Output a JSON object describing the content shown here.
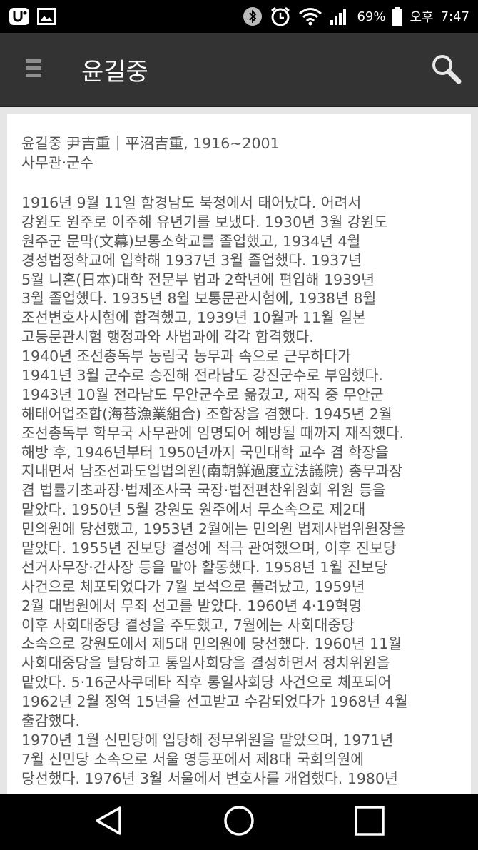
{
  "status_bar": {
    "battery_percent": "69%",
    "ampm": "오후",
    "time": "7:47"
  },
  "app_bar": {
    "title": "윤길중"
  },
  "entry": {
    "header": [
      "윤길중 尹吉重｜平沼吉重, 1916~2001",
      "사무관·군수"
    ],
    "body_lines": [
      "1916년 9월 11일 함경남도 북청에서 태어났다. 어려서",
      "강원도 원주로 이주해 유년기를 보냈다. 1930년 3월 강원도",
      "원주군 문막(文幕)보통소학교를 졸업했고, 1934년 4월",
      "경성법정학교에 입학해 1937년 3월 졸업했다. 1937년",
      "5월 니혼(日本)대학 전문부 법과 2학년에 편입해 1939년",
      "3월 졸업했다. 1935년 8월 보통문관시험에, 1938년 8월",
      "조선변호사시험에 합격했고, 1939년 10월과 11월 일본",
      "고등문관시험 행정과와 사법과에 각각 합격했다.",
      "1940년 조선총독부 농림국 농무과 속으로 근무하다가",
      "1941년 3월 군수로 승진해 전라남도 강진군수로 부임했다.",
      "1943년 10월 전라남도 무안군수로 옮겼고, 재직 중 무안군",
      "해태어업조합(海苔漁業組合) 조합장을 겸했다. 1945년 2월",
      "조선총독부 학무국 사무관에 임명되어 해방될 때까지 재직했다.",
      "해방 후, 1946년부터 1950년까지 국민대학 교수 겸 학장을",
      "지내면서 남조선과도입법의원(南朝鮮過度立法議院) 총무과장",
      "겸 법률기초과장·법제조사국 국장·법전편찬위원회 위원 등을",
      "맡았다. 1950년 5월 강원도 원주에서 무소속으로 제2대",
      "민의원에 당선했고, 1953년 2월에는 민의원 법제사법위원장을",
      "맡았다. 1955년 진보당 결성에 적극 관여했으며, 이후 진보당",
      "선거사무장·간사장 등을 맡아 활동했다. 1958년 1월 진보당",
      "사건으로 체포되었다가 7월 보석으로 풀려났고, 1959년",
      "2월 대법원에서 무죄 선고를 받았다. 1960년 4·19혁명",
      "이후 사회대중당 결성을 주도했고, 7월에는 사회대중당",
      "소속으로 강원도에서 제5대 민의원에 당선했다. 1960년 11월",
      "사회대중당을 탈당하고 통일사회당을 결성하면서 정치위원을",
      "맡았다. 5·16군사쿠데타 직후 통일사회당 사건으로 체포되어",
      "1962년 2월 징역 15년을 선고받고 수감되었다가 1968년 4월",
      "출감했다.",
      "1970년 1월 신민당에 입당해 정무위원을 맡았으며, 1971년",
      "7월 신민당 소속으로 서울 영등포에서 제8대 국회의원에",
      "당선했다. 1976년 3월 서울에서 변호사를 개업했다. 1980년"
    ]
  },
  "icons": {
    "menu": "hamburger-menu-icon",
    "search": "search-icon",
    "back": "back-triangle-icon",
    "home": "home-circle-icon",
    "recents": "recents-square-icon"
  }
}
